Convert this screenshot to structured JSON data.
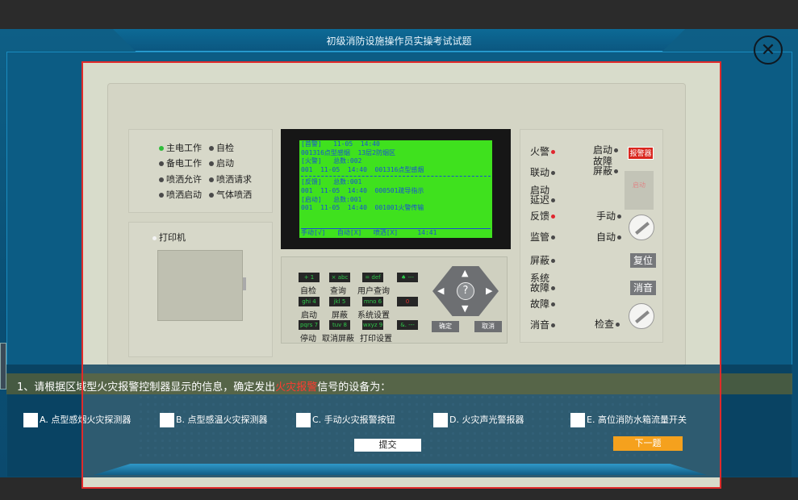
{
  "header": {
    "title": "初级消防设施操作员实操考试试题"
  },
  "panel": {
    "lamps": [
      {
        "label": "主电工作",
        "color": "#2fbd3a"
      },
      {
        "label": "自检",
        "color": "#4a4a4a"
      },
      {
        "label": "备电工作",
        "color": "#4a4a4a"
      },
      {
        "label": "启动",
        "color": "#4a4a4a"
      },
      {
        "label": "喷洒允许",
        "color": "#4a4a4a"
      },
      {
        "label": "喷洒请求",
        "color": "#4a4a4a"
      },
      {
        "label": "喷洒启动",
        "color": "#4a4a4a"
      },
      {
        "label": "气体喷洒",
        "color": "#4a4a4a"
      }
    ],
    "printer_label": "打印机",
    "lcd": {
      "lines": [
        "[首警]   11-05  14:40",
        "001316点型感烟  13层2防烟区",
        "[火警]   总数:002",
        "001  11-05  14:40  001316点型感烟",
        "[反馈]   总数:001",
        "001  11-05  14:40  000501疏导指示",
        "[启动]   总数:001",
        "001  11-05  14:40  001001火警传输"
      ],
      "status_bar": "手动[√]   自动[X]   喷洒[X]     14:41"
    },
    "keys": [
      {
        "top": "+ 1",
        "label": "自检"
      },
      {
        "top": "× abc",
        "label": "查询"
      },
      {
        "top": "= def",
        "label": "用户查询"
      },
      {
        "top": "♠ ---",
        "label": ""
      },
      {
        "top": "ghi 4",
        "label": "启动"
      },
      {
        "top": "jkl 5",
        "label": "屏蔽"
      },
      {
        "top": "mno 6",
        "label": "系统设置"
      },
      {
        "top": "0",
        "label": ""
      },
      {
        "top": "pqrs 7",
        "label": "停动"
      },
      {
        "top": "tuv 8",
        "label": "取消屏蔽"
      },
      {
        "top": "wxyz 9",
        "label": "打印设置"
      },
      {
        "top": "&. ---",
        "label": ""
      }
    ],
    "dpad_center": "?",
    "confirm_label": "确定",
    "cancel_label": "取消",
    "indicators_left": [
      {
        "label": "火警",
        "lamp": "#e0262e"
      },
      {
        "label": "联动",
        "lamp": "#4a4a4a"
      },
      {
        "label": "启动\n延迟",
        "lamp": "#4a4a4a"
      },
      {
        "label": "反馈",
        "lamp": "#e0262e"
      },
      {
        "label": "监管",
        "lamp": "#4a4a4a"
      },
      {
        "label": "屏蔽",
        "lamp": "#4a4a4a"
      },
      {
        "label": "系统\n故障",
        "lamp": "#4a4a4a"
      },
      {
        "label": "故障",
        "lamp": "#4a4a4a"
      },
      {
        "label": "消音",
        "lamp": "#4a4a4a"
      }
    ],
    "right_labels": {
      "start": "启动",
      "fault_mask": "故障\n屏蔽",
      "alarm_button": "报警器",
      "alarm_ghost": "启动",
      "manual": "手动",
      "auto": "自动",
      "reset": "复位",
      "silence": "消音",
      "check": "检查"
    }
  },
  "question": {
    "prefix": "1、请根据区域型火灾报警控制器显示的信息，确定发出",
    "highlight": "火灾报警",
    "suffix": "信号的设备为：",
    "options": [
      "A. 点型感烟火灾探测器",
      "B. 点型感温火灾探测器",
      "C. 手动火灾报警按钮",
      "D. 火灾声光警报器",
      "E. 高位消防水箱流量开关"
    ],
    "submit_label": "提交",
    "next_label": "下一题"
  },
  "colors": {
    "accent": "#f5a11d",
    "highlight": "#ff3b30",
    "frame_red": "#e02a2a"
  }
}
